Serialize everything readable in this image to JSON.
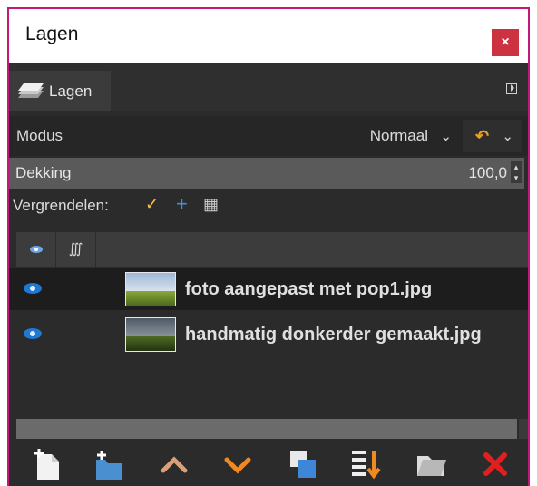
{
  "window": {
    "title": "Lagen",
    "close_label": "×"
  },
  "tab": {
    "label": "Lagen"
  },
  "mode": {
    "label": "Modus",
    "value": "Normaal"
  },
  "opacity": {
    "label": "Dekking",
    "value": "100,0"
  },
  "lock": {
    "label": "Vergrendelen:"
  },
  "layers": [
    {
      "name": "foto aangepast met pop1.jpg",
      "visible": true,
      "selected": true
    },
    {
      "name": "handmatig donkerder gemaakt.jpg",
      "visible": true,
      "selected": false
    }
  ],
  "colors": {
    "accent_border": "#c2187a",
    "close_red": "#cc3240",
    "eye_blue": "#1f78d1",
    "orange": "#f0a020"
  },
  "toolbar_icons": [
    "new-layer-icon",
    "new-layer-group-icon",
    "raise-layer-icon",
    "lower-layer-icon",
    "duplicate-layer-icon",
    "merge-layer-icon",
    "anchor-layer-icon",
    "delete-layer-icon"
  ]
}
